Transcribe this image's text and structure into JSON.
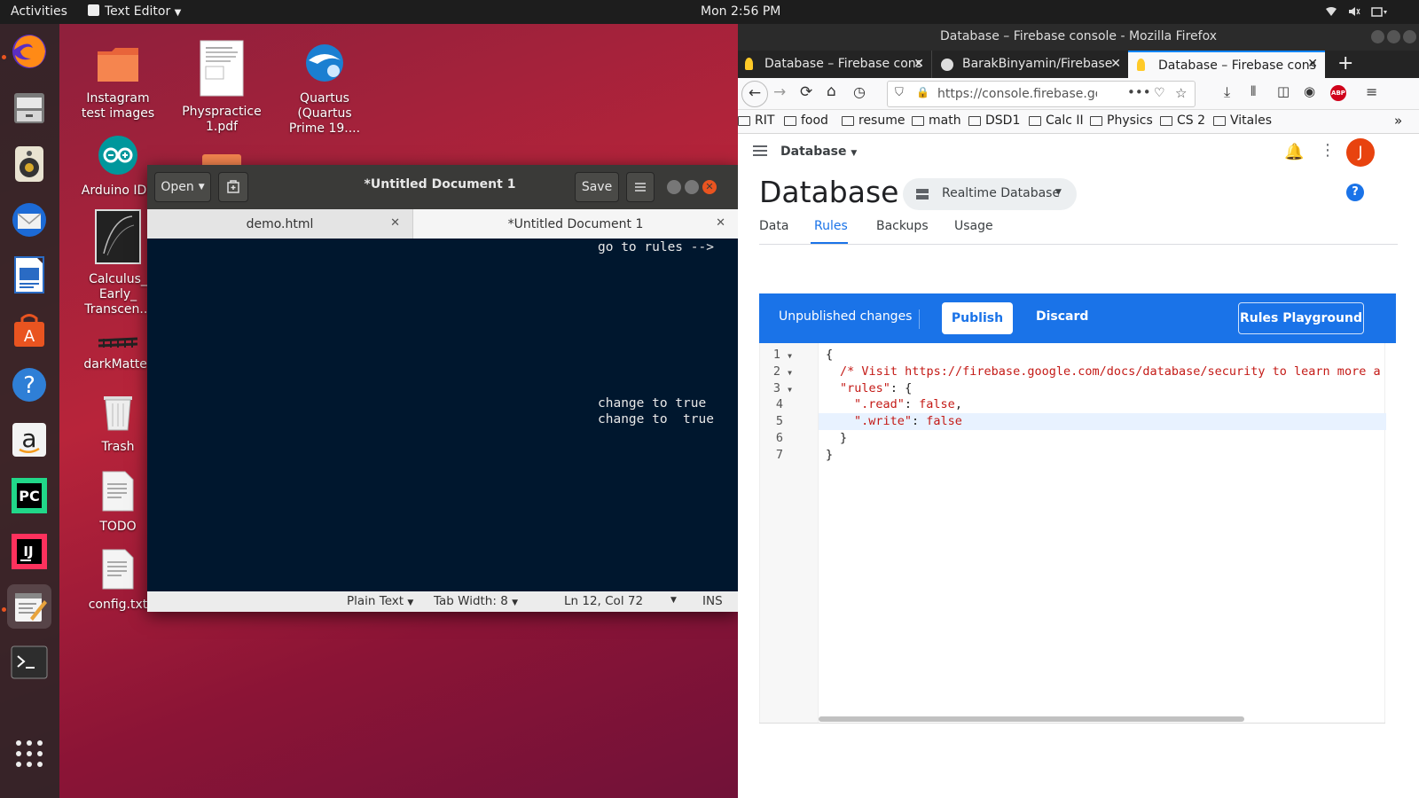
{
  "topbar": {
    "activities": "Activities",
    "app_menu": "Text Editor",
    "clock": "Mon  2:56 PM"
  },
  "desktop": {
    "icons": [
      {
        "label": "Instagram test images"
      },
      {
        "label": "Physpractice1.pdf"
      },
      {
        "label": "Quartus (Quartus Prime 19...."
      },
      {
        "label": "Arduino IDE"
      },
      {
        "label": "Calculus_ Early_ Transcen..."
      },
      {
        "label": "darkMatter"
      },
      {
        "label": "Trash"
      },
      {
        "label": "TODO"
      },
      {
        "label": "config.txt"
      }
    ]
  },
  "gedit": {
    "open_label": "Open",
    "save_label": "Save",
    "title": "*Untitled Document 1",
    "tabs": [
      {
        "label": "demo.html"
      },
      {
        "label": "*Untitled Document 1"
      }
    ],
    "lines": {
      "l1": "go to rules -->",
      "l2": "change to true",
      "l3": "change to  true"
    },
    "status": {
      "language": "Plain Text",
      "tab_width": "Tab Width: 8",
      "position": "Ln 12, Col 72",
      "mode": "INS"
    }
  },
  "firefox": {
    "window_title": "Database – Firebase console - Mozilla Firefox",
    "tabs": [
      {
        "label": "Database – Firebase cons"
      },
      {
        "label": "BarakBinyamin/Firebase"
      },
      {
        "label": "Database – Firebase cons"
      }
    ],
    "url": "https://console.firebase.go",
    "bookmarks": [
      "RIT",
      "food",
      "resume",
      "math",
      "DSD1",
      "Calc II",
      "Physics",
      "CS 2",
      "Vitales"
    ],
    "adblock": "ABP"
  },
  "firebase": {
    "breadcrumb": "Database",
    "avatar": "J",
    "page_title": "Database",
    "db_select": "Realtime Database",
    "tabs": [
      "Data",
      "Rules",
      "Backups",
      "Usage"
    ],
    "active_tab": "Rules",
    "unpublished": "Unpublished changes",
    "publish": "Publish",
    "discard": "Discard",
    "playground": "Rules Playground",
    "code_lines": [
      {
        "n": "1",
        "fold": true
      },
      {
        "n": "2",
        "fold": true
      },
      {
        "n": "3",
        "fold": true
      },
      {
        "n": "4",
        "fold": false
      },
      {
        "n": "5",
        "fold": false
      },
      {
        "n": "6",
        "fold": false
      },
      {
        "n": "7",
        "fold": false
      }
    ],
    "code": {
      "l1": "{",
      "l2": "/* Visit https://firebase.google.com/docs/database/security to learn more a",
      "l3_key": "\"rules\"",
      "l3_rest": ": {",
      "l4_key": "\".read\"",
      "l4_val": "false",
      "l5_key": "\".write\"",
      "l5_val": "false",
      "l6": "}",
      "l7": "}"
    }
  },
  "colors": {
    "ubuntu_orange": "#e95420",
    "firebase_blue": "#1a73e8",
    "editor_bg": "#00172e",
    "code_red": "#c41a16"
  }
}
